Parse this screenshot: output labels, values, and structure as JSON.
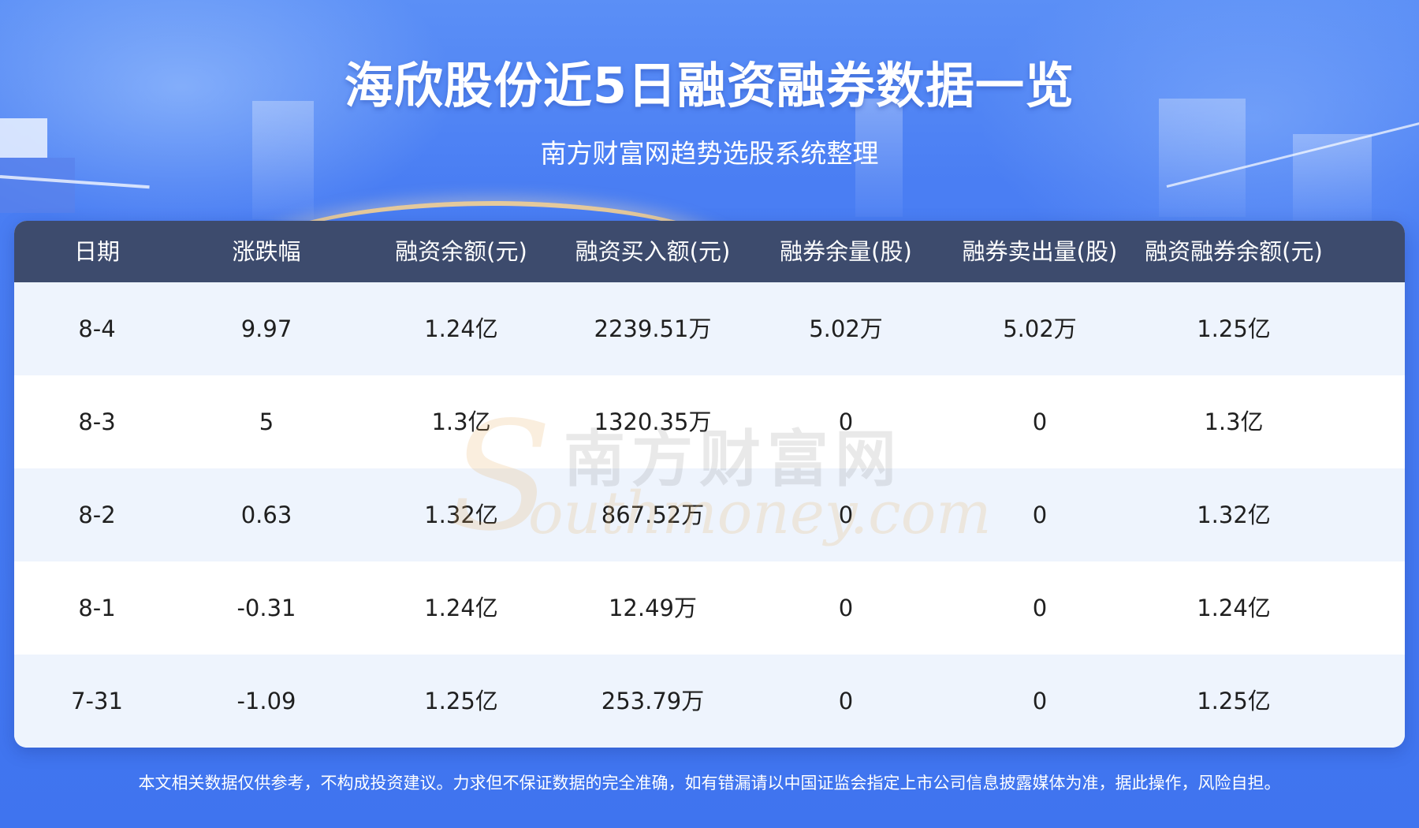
{
  "header": {
    "title": "海欣股份近5日融资融券数据一览",
    "subtitle": "南方财富网趋势选股系统整理"
  },
  "table": {
    "columns": [
      "日期",
      "涨跌幅",
      "融资余额(元)",
      "融资买入额(元)",
      "融券余量(股)",
      "融券卖出量(股)",
      "融资融券余额(元)"
    ],
    "rows": [
      [
        "8-4",
        "9.97",
        "1.24亿",
        "2239.51万",
        "5.02万",
        "5.02万",
        "1.25亿"
      ],
      [
        "8-3",
        "5",
        "1.3亿",
        "1320.35万",
        "0",
        "0",
        "1.3亿"
      ],
      [
        "8-2",
        "0.63",
        "1.32亿",
        "867.52万",
        "0",
        "0",
        "1.32亿"
      ],
      [
        "8-1",
        "-0.31",
        "1.24亿",
        "12.49万",
        "0",
        "0",
        "1.24亿"
      ],
      [
        "7-31",
        "-1.09",
        "1.25亿",
        "253.79万",
        "0",
        "0",
        "1.25亿"
      ]
    ]
  },
  "watermark": {
    "cn": "南方财富网",
    "en": "outhmoney.com",
    "logo_letter": "S"
  },
  "footer": {
    "note": "本文相关数据仅供参考，不构成投资建议。力求但不保证数据的完全准确，如有错漏请以中国证监会指定上市公司信息披露媒体为准，据此操作，风险自担。"
  },
  "colors": {
    "background": "#4a7ef3",
    "table_header": "#3d4b6d",
    "row_alt": "#eef4fd",
    "row_plain": "#ffffff"
  }
}
